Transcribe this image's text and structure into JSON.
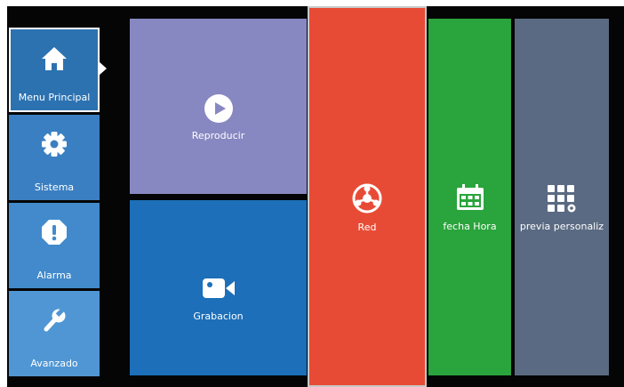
{
  "sidebar": {
    "items": [
      {
        "label": "Menu Principal",
        "icon": "home-icon",
        "color": "#2c72b1",
        "selected": true
      },
      {
        "label": "Sistema",
        "icon": "gear-icon",
        "color": "#3a7fc2"
      },
      {
        "label": "Alarma",
        "icon": "alert-octagon-icon",
        "color": "#428acb"
      },
      {
        "label": "Avanzado",
        "icon": "wrench-icon",
        "color": "#5096d4"
      }
    ]
  },
  "tiles": {
    "reproducir": {
      "label": "Reproducir",
      "icon": "play-icon",
      "color": "#8787c1"
    },
    "grabacion": {
      "label": "Grabacion",
      "icon": "video-camera-icon",
      "color": "#1c6fb8"
    },
    "red": {
      "label": "Red",
      "icon": "network-icon",
      "color": "#e84b35"
    },
    "fecha_hora": {
      "label": "fecha Hora",
      "icon": "calendar-icon",
      "color": "#2aa43c"
    },
    "previa": {
      "label": "previa personaliz",
      "icon": "grid-settings-icon",
      "color": "#5a6a82"
    }
  }
}
